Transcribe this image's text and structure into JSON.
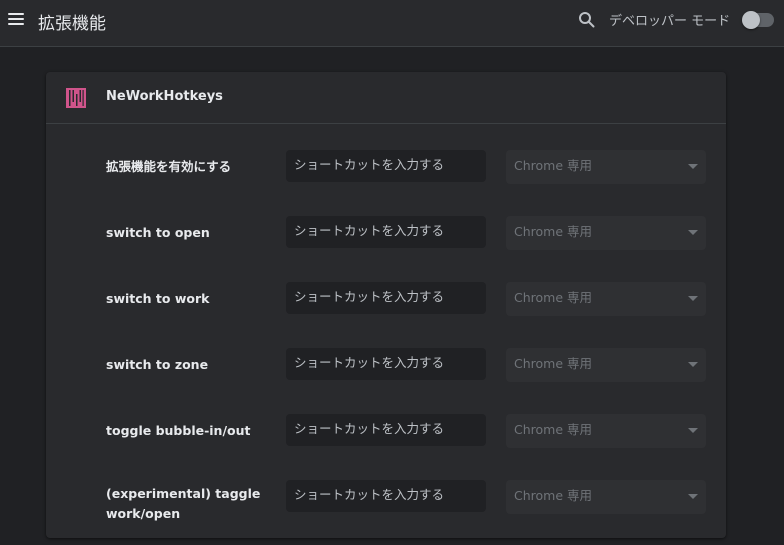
{
  "header": {
    "title": "拡張機能",
    "developer_mode_label": "デベロッパー モード",
    "developer_mode_on": false
  },
  "extension": {
    "name": "NeWorkHotkeys",
    "logo_color": "#d0548b"
  },
  "commands": [
    {
      "label": "拡張機能を有効にする",
      "shortcut_placeholder": "ショートカットを入力する",
      "scope": "Chrome 専用"
    },
    {
      "label": "switch to open",
      "shortcut_placeholder": "ショートカットを入力する",
      "scope": "Chrome 専用"
    },
    {
      "label": "switch to work",
      "shortcut_placeholder": "ショートカットを入力する",
      "scope": "Chrome 専用"
    },
    {
      "label": "switch to zone",
      "shortcut_placeholder": "ショートカットを入力する",
      "scope": "Chrome 専用"
    },
    {
      "label": "toggle bubble-in/out",
      "shortcut_placeholder": "ショートカットを入力する",
      "scope": "Chrome 専用"
    },
    {
      "label": "(experimental) taggle work/open",
      "shortcut_placeholder": "ショートカットを入力する",
      "scope": "Chrome 専用"
    }
  ]
}
